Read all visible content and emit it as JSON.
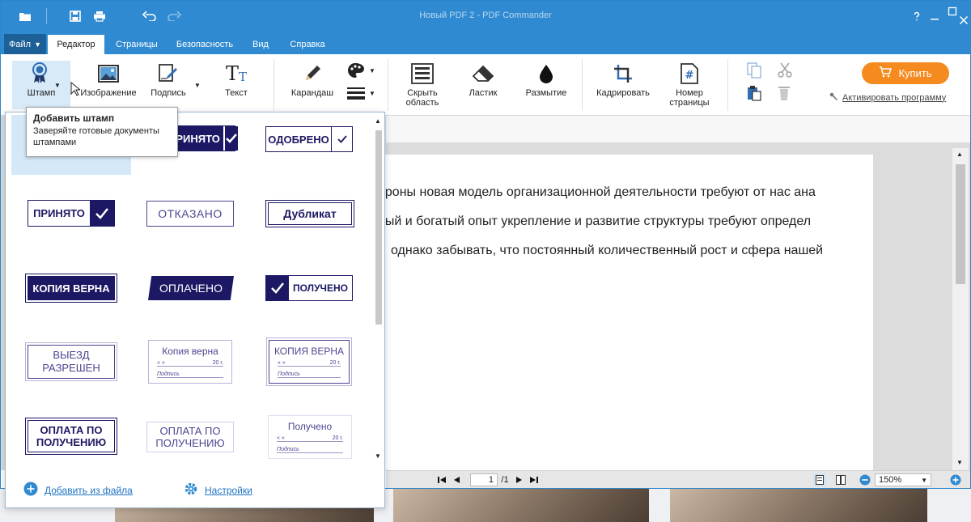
{
  "window": {
    "title": "Новый PDF 2 - PDF Commander"
  },
  "menu": {
    "file_label": "Файл",
    "tabs": [
      "Редактор",
      "Страницы",
      "Безопасность",
      "Вид",
      "Справка"
    ]
  },
  "ribbon": {
    "stamp": "Штамп",
    "image": "Изображение",
    "signature": "Подпись",
    "text": "Текст",
    "pencil": "Карандаш",
    "hide_area_1": "Скрыть",
    "hide_area_2": "область",
    "eraser": "Ластик",
    "blur": "Размытие",
    "crop": "Кадрировать",
    "page_number_1": "Номер",
    "page_number_2": "страницы",
    "buy": "Купить",
    "activate": "Активировать программу"
  },
  "tooltip": {
    "title": "Добавить штамп",
    "text": "Заверяйте готовые документы штампами"
  },
  "stamps": {
    "accepted": "ПРИНЯТО",
    "approved": "ОДОБРЕНО",
    "rejected": "ОТКАЗАНО",
    "duplicate": "Дубликат",
    "copy_true": "КОПИЯ ВЕРНА",
    "paid": "ОПЛАЧЕНО",
    "received": "ПОЛУЧЕНО",
    "exit_allowed_1": "ВЫЕЗД",
    "exit_allowed_2": "РАЗРЕШЕН",
    "form_copy_lower": "Копия верна",
    "form_copy_upper": "КОПИЯ ВЕРНА",
    "form_received": "Получено",
    "form_date_left": "«     »",
    "form_year": "20     г.",
    "form_sign": "Подпись",
    "pay_on_receipt_1": "ОПЛАТА ПО",
    "pay_on_receipt_2": "ПОЛУЧЕНИЮ"
  },
  "popup_footer": {
    "add_from_file": "Добавить из файла",
    "settings": "Настройки"
  },
  "document": {
    "lines": [
      "ороны новая модель организационной деятельности требуют от нас ана",
      "ный и богатый опыт укрепление и развитие структуры требуют определ",
      "однако забывать, что постоянный количественный рост и сфера нашей"
    ]
  },
  "status": {
    "current_page": "1",
    "total_pages": "/1",
    "zoom": "150%"
  },
  "colors": {
    "titlebar": "#2f8ad1",
    "stamp_ink": "#1d1864",
    "buy": "#f58a1f"
  }
}
